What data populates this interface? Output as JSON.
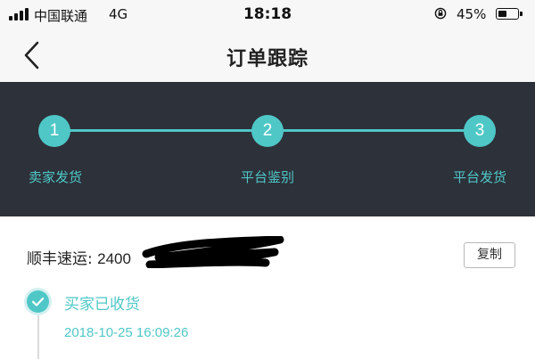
{
  "status_bar": {
    "carrier": "中国联通",
    "network": "4G",
    "time": "18:18",
    "battery_percent": "45%",
    "battery_level": 0.45
  },
  "nav": {
    "back_icon": "chevron-left-icon",
    "title": "订单跟踪"
  },
  "progress": {
    "steps": [
      {
        "number": "1",
        "label": "卖家发货"
      },
      {
        "number": "2",
        "label": "平台鉴别"
      },
      {
        "number": "3",
        "label": "平台发货"
      }
    ],
    "accent_color": "#4fc7c7",
    "panel_color": "#2d313a"
  },
  "shipment": {
    "courier_label": "顺丰速运:",
    "tracking_number_visible": "2400",
    "copy_label": "复制"
  },
  "timeline": {
    "events": [
      {
        "status": "买家已收货",
        "time": "2018-10-25 16:09:26"
      }
    ]
  }
}
